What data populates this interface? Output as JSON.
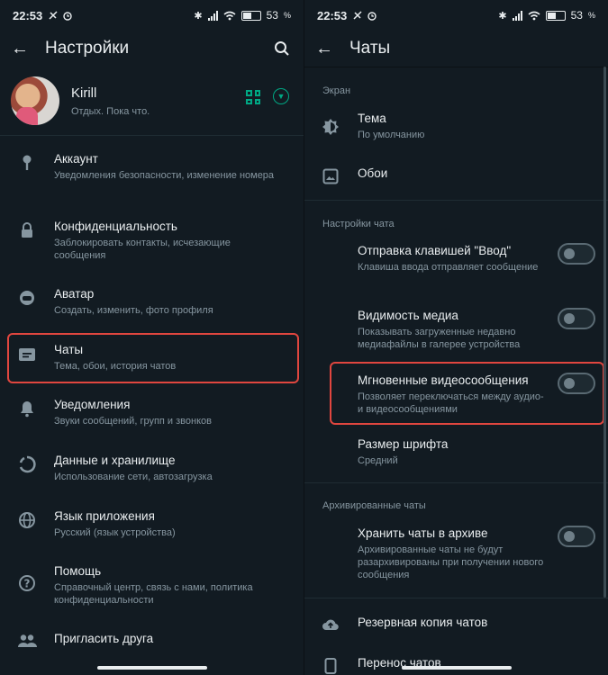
{
  "status": {
    "time": "22:53",
    "battery": "53",
    "battery_level": 0.53
  },
  "left": {
    "title": "Настройки",
    "profile": {
      "name": "Kirill",
      "status": "Отдых. Пока что."
    },
    "items": [
      {
        "title": "Аккаунт",
        "subtitle": "Уведомления безопасности, изменение номера",
        "icon": "key-icon"
      },
      {
        "title": "Конфиденциальность",
        "subtitle": "Заблокировать контакты, исчезающие сообщения",
        "icon": "lock-icon"
      },
      {
        "title": "Аватар",
        "subtitle": "Создать, изменить, фото профиля",
        "icon": "avatar-face-icon"
      },
      {
        "title": "Чаты",
        "subtitle": "Тема, обои, история чатов",
        "icon": "chat-icon"
      },
      {
        "title": "Уведомления",
        "subtitle": "Звуки сообщений, групп и звонков",
        "icon": "bell-icon"
      },
      {
        "title": "Данные и хранилище",
        "subtitle": "Использование сети, автозагрузка",
        "icon": "data-usage-icon"
      },
      {
        "title": "Язык приложения",
        "subtitle": "Русский (язык устройства)",
        "icon": "globe-icon"
      },
      {
        "title": "Помощь",
        "subtitle": "Справочный центр, связь с нами, политика конфиденциальности",
        "icon": "help-icon"
      },
      {
        "title": "Пригласить друга",
        "subtitle": "",
        "icon": "people-icon"
      }
    ]
  },
  "right": {
    "title": "Чаты",
    "section_screen": "Экран",
    "theme": {
      "title": "Тема",
      "subtitle": "По умолчанию"
    },
    "wallpaper": {
      "title": "Обои"
    },
    "section_chat": "Настройки чата",
    "enter_key": {
      "title": "Отправка клавишей \"Ввод\"",
      "subtitle": "Клавиша ввода отправляет сообщение",
      "enabled": false
    },
    "media_visibility": {
      "title": "Видимость медиа",
      "subtitle": "Показывать загруженные недавно медиафайлы в галерее устройства",
      "enabled": false
    },
    "instant_video": {
      "title": "Мгновенные видеосообщения",
      "subtitle": "Позволяет переключаться между аудио- и видеосообщениями",
      "enabled": false
    },
    "font_size": {
      "title": "Размер шрифта",
      "subtitle": "Средний"
    },
    "section_archive": "Архивированные чаты",
    "keep_archived": {
      "title": "Хранить чаты в архиве",
      "subtitle": "Архивированные чаты не будут разархивированы при получении нового сообщения",
      "enabled": false
    },
    "backup": {
      "title": "Резервная копия чатов"
    },
    "transfer": {
      "title": "Перенос чатов"
    }
  },
  "colors": {
    "accent": "#00a884",
    "highlight": "#e0463f",
    "background": "#121b22"
  }
}
